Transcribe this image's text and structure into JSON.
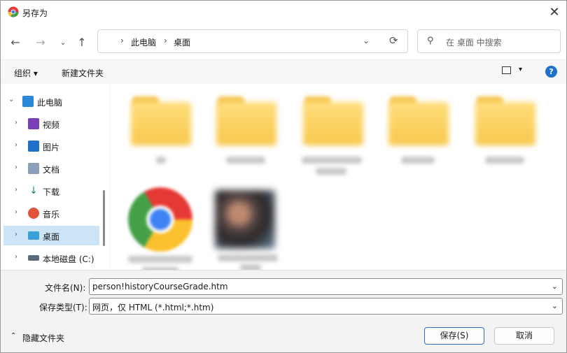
{
  "window": {
    "title": "另存为"
  },
  "nav": {
    "back": "←",
    "forward": "→",
    "recent": "⌄",
    "up": "↑",
    "breadcrumb": [
      "此电脑",
      "桌面"
    ],
    "refresh": "⟳"
  },
  "search": {
    "placeholder": "在 桌面 中搜索"
  },
  "toolbar": {
    "organize": "组织 ▾",
    "new_folder": "新建文件夹",
    "help": "?"
  },
  "sidebar": {
    "items": [
      {
        "label": "此电脑",
        "icon": "computer-icon",
        "color": "#2b88d8"
      },
      {
        "label": "视频",
        "icon": "video-icon",
        "color": "#7a3fb8"
      },
      {
        "label": "图片",
        "icon": "picture-icon",
        "color": "#1e72c9"
      },
      {
        "label": "文档",
        "icon": "document-icon",
        "color": "#8aa0b8"
      },
      {
        "label": "下载",
        "icon": "download-icon",
        "color": "#1a8a5a"
      },
      {
        "label": "音乐",
        "icon": "music-icon",
        "color": "#e0533a"
      },
      {
        "label": "桌面",
        "icon": "desktop-icon",
        "color": "#39a0d8"
      },
      {
        "label": "本地磁盘 (C:)",
        "icon": "drive-icon",
        "color": "#5a6a7a"
      }
    ]
  },
  "footer": {
    "filename_label": "文件名(N):",
    "filename_value": "person!historyCourseGrade.htm",
    "filetype_label": "保存类型(T):",
    "filetype_value": "网页，仅 HTML (*.html;*.htm)",
    "hide_folders": "隐藏文件夹",
    "save": "保存(S)",
    "cancel": "取消"
  },
  "colors": {
    "accent": "#2d6fb5",
    "selected": "#cce4f7",
    "help": "#1e72c9"
  }
}
